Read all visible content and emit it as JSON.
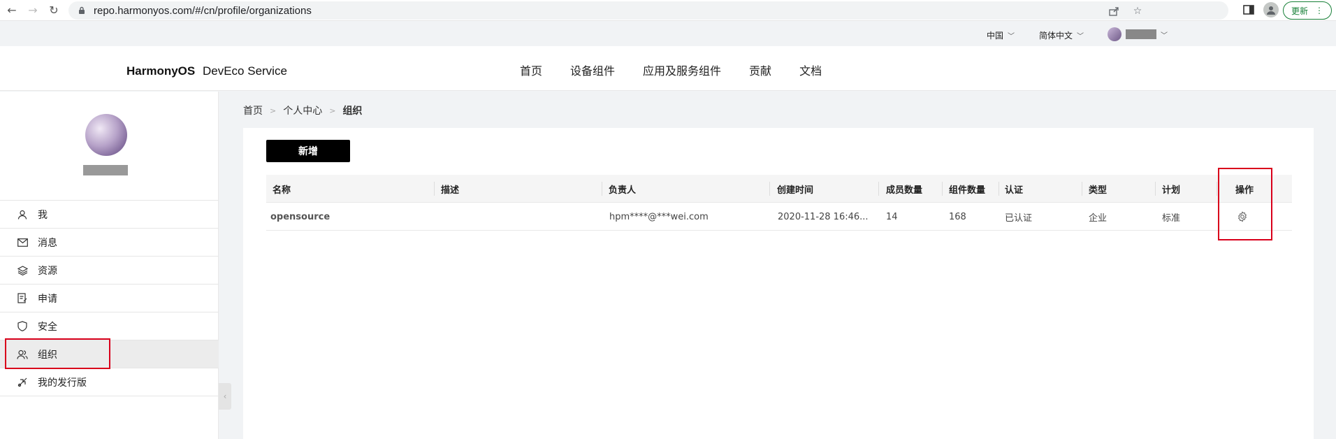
{
  "browser": {
    "url": "repo.harmonyos.com/#/cn/profile/organizations",
    "update_label": "更新"
  },
  "util_bar": {
    "region": "中国",
    "language": "简体中文"
  },
  "header": {
    "logo_brand": "HarmonyOS",
    "logo_product": "DevEco Service",
    "nav": [
      "首页",
      "设备组件",
      "应用及服务组件",
      "贡献",
      "文档"
    ]
  },
  "sidebar": {
    "items": [
      {
        "label": "我",
        "icon": "user-icon"
      },
      {
        "label": "消息",
        "icon": "mail-icon"
      },
      {
        "label": "资源",
        "icon": "layers-icon"
      },
      {
        "label": "申请",
        "icon": "clipboard-icon"
      },
      {
        "label": "安全",
        "icon": "shield-icon"
      },
      {
        "label": "组织",
        "icon": "users-icon",
        "active": true
      },
      {
        "label": "我的发行版",
        "icon": "release-icon"
      }
    ]
  },
  "breadcrumb": [
    "首页",
    "个人中心",
    "组织"
  ],
  "content": {
    "add_button": "新增"
  },
  "table": {
    "headers": [
      "名称",
      "描述",
      "负责人",
      "创建时间",
      "成员数量",
      "组件数量",
      "认证",
      "类型",
      "计划",
      "操作"
    ],
    "rows": [
      {
        "name": "opensource",
        "description": "",
        "owner": "hpm****@***wei.com",
        "created": "2020-11-28 16:46...",
        "members": "14",
        "components": "168",
        "certification": "已认证",
        "type": "企业",
        "plan": "标准",
        "action_icon": "gear-icon"
      }
    ]
  },
  "colors": {
    "highlight": "#d9001b",
    "primary_button": "#000000",
    "update_green": "#188038"
  }
}
